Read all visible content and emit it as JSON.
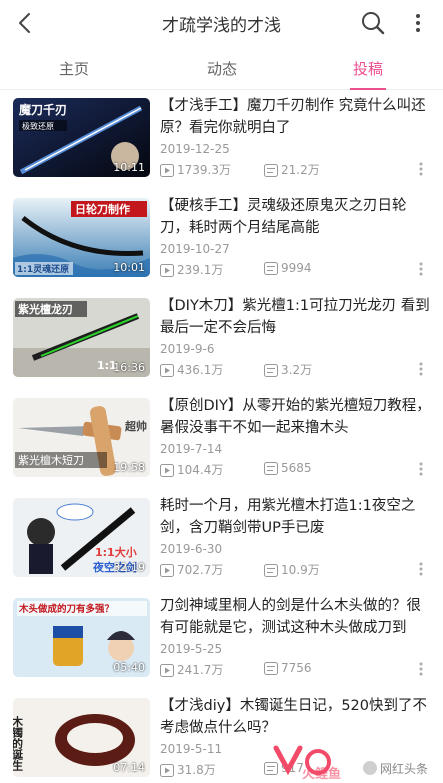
{
  "header": {
    "title": "才疏学浅的才浅"
  },
  "tabs": [
    {
      "label": "主页",
      "active": false
    },
    {
      "label": "动态",
      "active": false
    },
    {
      "label": "投稿",
      "active": true
    }
  ],
  "accent_color": "#ee4f8f",
  "videos": [
    {
      "title": "【才浅手工】魔刀千刃制作  究竟什么叫还原？看完你就明白了",
      "date": "2019-12-25",
      "plays": "1739.3万",
      "comments": "21.2万",
      "duration": "10:11",
      "thumb_text": "魔刀千刃",
      "thumb_sub": "极致还原"
    },
    {
      "title": "【硬核手工】灵魂级还原鬼灭之刃日轮刀，耗时两个月结尾高能",
      "date": "2019-10-27",
      "plays": "239.1万",
      "comments": "9994",
      "duration": "10:01",
      "thumb_text": "日轮刀制作",
      "thumb_sub": "1:1灵魂还原"
    },
    {
      "title": "【DIY木刀】紫光檀1:1可拉刀光龙刃  看到最后一定不会后悔",
      "date": "2019-9-6",
      "plays": "436.1万",
      "comments": "3.2万",
      "duration": "16:36",
      "thumb_text": "紫光檀龙刃",
      "thumb_sub": "1:1"
    },
    {
      "title": "【原创DIY】从零开始的紫光檀短刀教程，暑假没事干不如一起来撸木头",
      "date": "2019-7-14",
      "plays": "104.4万",
      "comments": "5685",
      "duration": "19:58",
      "thumb_text": "紫光檀木短刀",
      "thumb_sub": "超帅"
    },
    {
      "title": "耗时一个月，用紫光檀木打造1:1夜空之剑，含刀鞘剑带UP手已废",
      "date": "2019-6-30",
      "plays": "702.7万",
      "comments": "10.9万",
      "duration": "32:19",
      "thumb_text": "1:1大小",
      "thumb_sub": "夜空之剑"
    },
    {
      "title": "刀剑神域里桐人的剑是什么木头做的？很有可能就是它，测试这种木头做成刀到",
      "date": "2019-5-25",
      "plays": "241.7万",
      "comments": "7756",
      "duration": "05:40",
      "thumb_text": "木头做成的刀有多强？",
      "thumb_sub": ""
    },
    {
      "title": "【才浅diy】木镯诞生日记，520快到了不考虑做点什么吗？",
      "date": "2019-5-11",
      "plays": "31.8万",
      "comments": "917",
      "duration": "07:14",
      "thumb_text": "木镯的诞生",
      "thumb_sub": ""
    }
  ],
  "watermark": {
    "text": "网红头条",
    "logo_text": "火鲤鱼"
  }
}
